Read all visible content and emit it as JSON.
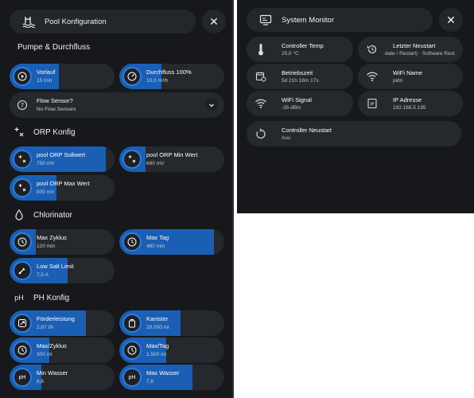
{
  "pool": {
    "title": "Pool Konfiguration",
    "close_label": "✕",
    "sections": {
      "pumpe": "Pumpe & Durchfluss",
      "orp": "ORP Konfig",
      "chlor": "Chlorinator",
      "ph": "PH Konfig"
    },
    "ph_section_icon": "pH",
    "tiles": {
      "vorlauf": {
        "label": "Vorlauf",
        "value": "15 min"
      },
      "durchfluss": {
        "label": "Durchfluss 100%",
        "value": "10,0 m³/h"
      },
      "flow_sensor": {
        "label": "Flow Sensor?",
        "value": "No Flow Sensors"
      },
      "orp_soll": {
        "label": "pool ORP Sollwert",
        "value": "750 mV"
      },
      "orp_min": {
        "label": "pool ORP Min Wert",
        "value": "680 mV"
      },
      "orp_max": {
        "label": "pool ORP Max Wert",
        "value": "800 mV"
      },
      "max_zyklus": {
        "label": "Max Zyklus",
        "value": "120 min"
      },
      "max_tag": {
        "label": "Max Tag",
        "value": "480 min"
      },
      "low_salt": {
        "label": "Low Salt Limit",
        "value": "7,5 A"
      },
      "foerderleistung": {
        "label": "Förderleistung",
        "value": "2,67 l/h"
      },
      "kanister": {
        "label": "Kanister",
        "value": "20.000 ml"
      },
      "max_zyklus_ph": {
        "label": "Max/Zyklus",
        "value": "300 ml"
      },
      "max_tag_ph": {
        "label": "Max/Tag",
        "value": "1.500 ml"
      },
      "min_wasser": {
        "label": "Min Wasser",
        "value": "6,8",
        "icon_text": "pH"
      },
      "max_wasser": {
        "label": "Max Wasser",
        "value": "7,8",
        "icon_text": "pH"
      }
    },
    "fill_fractions": {
      "vorlauf": 0.47,
      "durchfluss": 0.4,
      "orp_soll": 0.92,
      "orp_min": 0.25,
      "orp_max": 0.45,
      "max_zyklus": 0.25,
      "max_tag": 0.9,
      "low_salt": 0.55,
      "foerderleistung": 0.73,
      "kanister": 0.58,
      "max_zyklus_ph": 0.38,
      "max_tag_ph": 0.45,
      "min_wasser": 0.3,
      "max_wasser": 0.7
    }
  },
  "system": {
    "title": "System Monitor",
    "close_label": "✕",
    "tiles": {
      "controller_temp": {
        "label": "Controller Temp",
        "value": "25,0 °C"
      },
      "letzter_neustart": {
        "label": "Letzter Neustart",
        "value": "date / Restart) · Software Rest"
      },
      "betriebszeit": {
        "label": "Betriebszeit",
        "value": "5d 21h 18m 17s"
      },
      "wifi_name": {
        "label": "WiFi Name",
        "value": "pidri"
      },
      "wifi_signal": {
        "label": "WiFi Signal",
        "value": "-35 dBm"
      },
      "ip_adresse": {
        "label": "IP Adresse",
        "value": "192.168.5.195"
      },
      "controller_neustart": {
        "label": "Controller Neustart",
        "value": "Aus"
      }
    }
  },
  "colors": {
    "accent": "#1a5fb4",
    "ring": "#2f7de0",
    "tile_bg": "#25282d",
    "panel_bg": "#16181c"
  }
}
